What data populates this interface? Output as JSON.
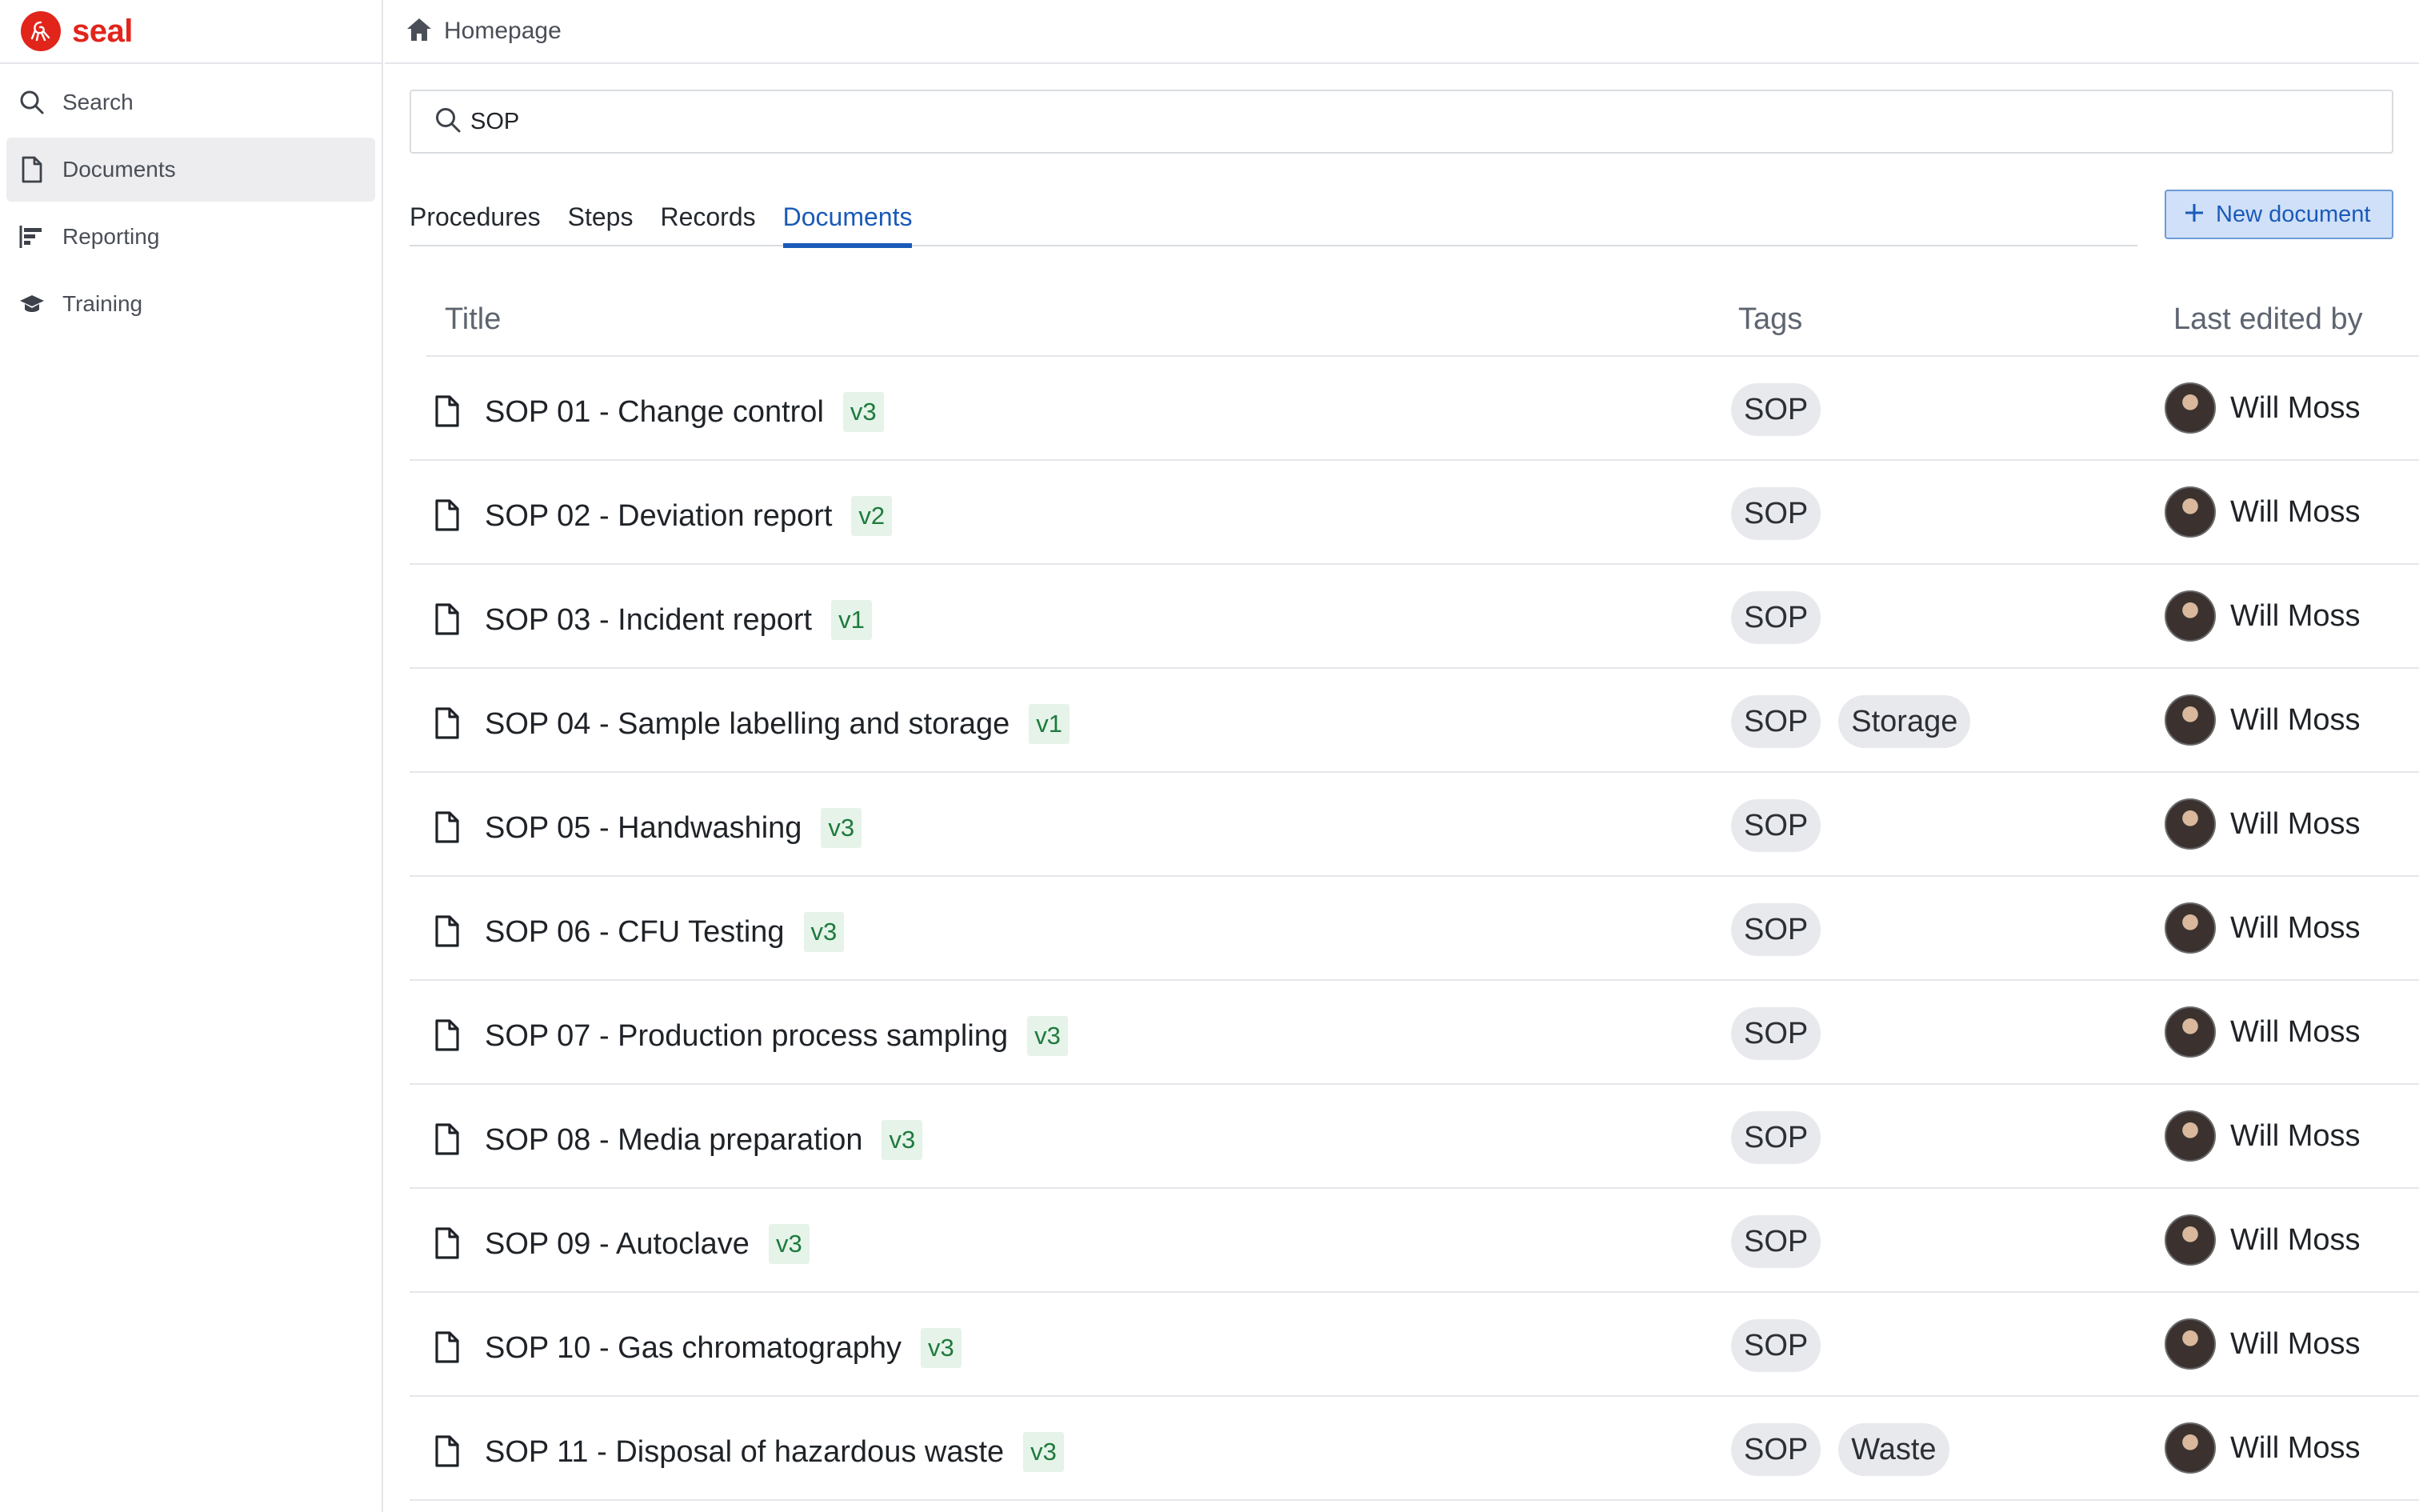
{
  "app": {
    "brand": "seal",
    "brand_color": "#e1251b"
  },
  "sidebar": {
    "items": [
      {
        "label": "Search",
        "icon": "search-icon",
        "active": false
      },
      {
        "label": "Documents",
        "icon": "document-icon",
        "active": true
      },
      {
        "label": "Reporting",
        "icon": "reporting-icon",
        "active": false
      },
      {
        "label": "Training",
        "icon": "graduation-cap-icon",
        "active": false
      }
    ]
  },
  "header": {
    "title": "Homepage",
    "icon": "home-icon"
  },
  "search": {
    "value": "SOP",
    "placeholder": ""
  },
  "tabs": [
    {
      "label": "Procedures",
      "active": false
    },
    {
      "label": "Steps",
      "active": false
    },
    {
      "label": "Records",
      "active": false
    },
    {
      "label": "Documents",
      "active": true
    }
  ],
  "actions": {
    "new_document_label": "New document"
  },
  "table": {
    "columns": {
      "title": "Title",
      "tags": "Tags",
      "edited_by": "Last edited by"
    },
    "rows": [
      {
        "title": "SOP 01 - Change control",
        "version": "v3",
        "tags": [
          "SOP"
        ],
        "editor": "Will Moss"
      },
      {
        "title": "SOP 02 - Deviation report",
        "version": "v2",
        "tags": [
          "SOP"
        ],
        "editor": "Will Moss"
      },
      {
        "title": "SOP 03 - Incident report",
        "version": "v1",
        "tags": [
          "SOP"
        ],
        "editor": "Will Moss"
      },
      {
        "title": "SOP 04 - Sample labelling and storage",
        "version": "v1",
        "tags": [
          "SOP",
          "Storage"
        ],
        "editor": "Will Moss"
      },
      {
        "title": "SOP 05 - Handwashing",
        "version": "v3",
        "tags": [
          "SOP"
        ],
        "editor": "Will Moss"
      },
      {
        "title": "SOP 06 - CFU Testing",
        "version": "v3",
        "tags": [
          "SOP"
        ],
        "editor": "Will Moss"
      },
      {
        "title": "SOP 07 - Production process sampling",
        "version": "v3",
        "tags": [
          "SOP"
        ],
        "editor": "Will Moss"
      },
      {
        "title": "SOP 08 - Media preparation",
        "version": "v3",
        "tags": [
          "SOP"
        ],
        "editor": "Will Moss"
      },
      {
        "title": "SOP 09 - Autoclave",
        "version": "v3",
        "tags": [
          "SOP"
        ],
        "editor": "Will Moss"
      },
      {
        "title": "SOP 10 - Gas chromatography",
        "version": "v3",
        "tags": [
          "SOP"
        ],
        "editor": "Will Moss"
      },
      {
        "title": "SOP 11 - Disposal of hazardous waste",
        "version": "v3",
        "tags": [
          "SOP",
          "Waste"
        ],
        "editor": "Will Moss"
      }
    ]
  },
  "colors": {
    "accent": "#1a5ab8",
    "version_bg": "#e5f3e9",
    "version_text": "#1e7a3c"
  }
}
